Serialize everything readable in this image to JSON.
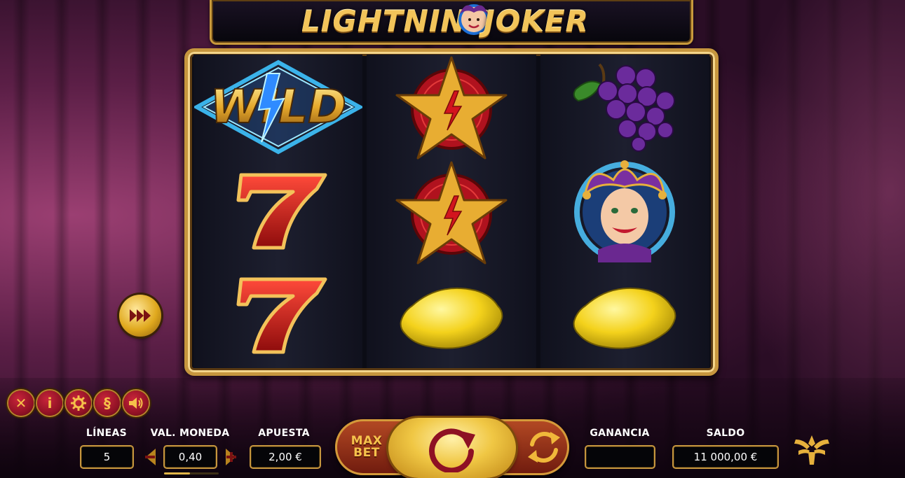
{
  "game": {
    "title_left": "LIGHTNING",
    "title_right": "JOKER"
  },
  "reels": [
    [
      "wild",
      "seven",
      "seven"
    ],
    [
      "star",
      "star",
      "lemon"
    ],
    [
      "grapes",
      "joker",
      "lemon"
    ]
  ],
  "symbols": {
    "wild_text": "WILD"
  },
  "controls": {
    "lines_label": "LÍNEAS",
    "lines_value": "5",
    "coin_label": "VAL. MONEDA",
    "coin_value": "0,40",
    "coin_minus": "−",
    "coin_plus": "+",
    "bet_label": "APUESTA",
    "bet_value": "2,00 €",
    "maxbet_line1": "MAX",
    "maxbet_line2": "BET",
    "win_label": "GANANCIA",
    "win_value": "",
    "balance_label": "SALDO",
    "balance_value": "11 000,00 €",
    "coin_level_fraction": 0.48
  },
  "utility_buttons": {
    "close": "✕",
    "info": "i",
    "settings": "settings-icon",
    "rules": "§",
    "sound": "sound-icon"
  },
  "colors": {
    "gold": "#c6963e",
    "accent_red": "#8e1124"
  }
}
